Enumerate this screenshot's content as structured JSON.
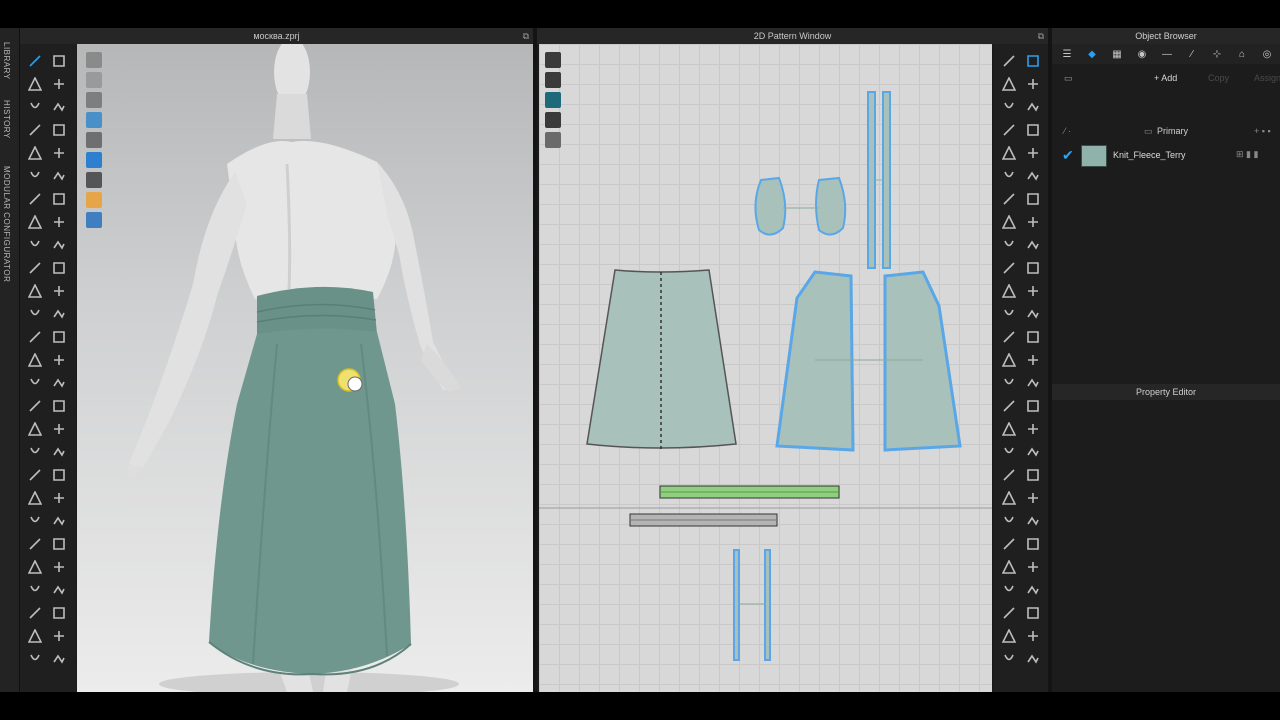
{
  "side_tabs": [
    "LIBRARY",
    "HISTORY",
    "MODULAR CONFIGURATOR"
  ],
  "viewport3d": {
    "title": "москва.zprj"
  },
  "pattern_window": {
    "title": "2D Pattern Window"
  },
  "object_browser": {
    "title": "Object Browser",
    "add_label": "+ Add",
    "copy_label": "Copy",
    "assign_label": "Assign",
    "section_label": "Primary",
    "fabric_name": "Knit_Fleece_Terry",
    "fabric_color": "#8fb3ab"
  },
  "property_editor": {
    "title": "Property Editor"
  },
  "colors": {
    "accent": "#2aa0f0",
    "garment": "#6f978d",
    "pattern_fill": "#a9c1bb",
    "selected_outline": "#5aa7e8",
    "binding_strip": "#8fcf7f"
  }
}
